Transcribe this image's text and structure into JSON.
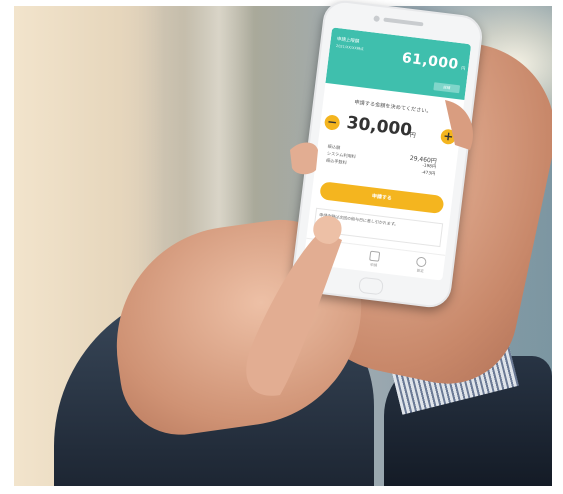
{
  "app": {
    "header": {
      "label": "申請上限額",
      "sub": "2021/XX/XX時点",
      "amount": "61,000",
      "yen": "円",
      "button": "詳細"
    },
    "prompt": "申請する金額を決めてください。",
    "stepper": {
      "minus": "−",
      "value": "30,000",
      "yen": "円",
      "plus": "+"
    },
    "details": [
      {
        "label": "振込額",
        "value": "29,460円"
      },
      {
        "label": "システム利用料",
        "value": "-198円"
      },
      {
        "label": "振込手数料",
        "value": "-473円"
      }
    ],
    "apply_button": "申請する",
    "note": "申請金額は次回の給与日に差し引かれます。",
    "tabs": [
      {
        "label": "ホーム"
      },
      {
        "label": "申請"
      },
      {
        "label": "設定"
      }
    ]
  },
  "colors": {
    "header": "#3fbfad",
    "accent": "#f4b51f"
  }
}
